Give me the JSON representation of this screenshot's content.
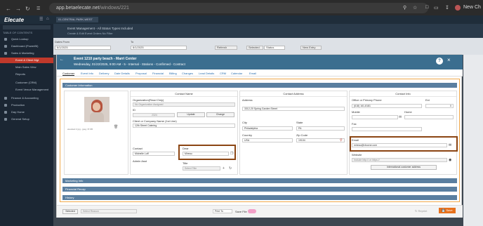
{
  "browser": {
    "url_host": "app.betaelecate.net",
    "url_path": "/windows/221",
    "profile_label": "New Ch"
  },
  "app": {
    "logo": "Elecate",
    "site_selector": "01-CENTRAL PARK-WEST"
  },
  "sidebar": {
    "heading": "TABLE OF CONTENTS",
    "items": [
      {
        "label": "Quick Lookup"
      },
      {
        "label": "Dashboard (PowerBI)"
      },
      {
        "label": "Sales & Marketing"
      },
      {
        "label": "Event & Client Mgt"
      },
      {
        "label": "Main Sales View"
      },
      {
        "label": "Reports"
      },
      {
        "label": "Customer (CRM)"
      },
      {
        "label": "Event Venue Management"
      },
      {
        "label": "Finance & Accounting"
      },
      {
        "label": "Production"
      },
      {
        "label": "Day Home"
      },
      {
        "label": "General Setup"
      }
    ]
  },
  "topstrip": {
    "title": "Event Management - All Status Types Included",
    "subtitle": "Create & Edit Event Orders No Filter"
  },
  "filters": {
    "date_from_label": "Dates From",
    "date_from": "6/1/2025",
    "to_label": "To",
    "date_to": "8/1/2025",
    "refresh": "Refresh",
    "selected": "Selected",
    "status": "Status",
    "new_entry": "New Entry"
  },
  "modal": {
    "title": "Event 1210 party beach - Marri Center",
    "subtitle": "Wednesday, 01/22/2025, 9:00 AM - 5 - Internal - Stations - Confirmed - Contract",
    "help_icon": "?",
    "tabs": [
      "Customer",
      "Event Info",
      "Delivery",
      "Date Details",
      "Proposal",
      "Financial",
      "Billing",
      "Changes",
      "Lead Details",
      "CRM",
      "Calendar",
      "Email"
    ],
    "section_customer": "Customer Information",
    "photo_caption": "elevated 2 jpg - jpeg / 8 KB",
    "contact_name": {
      "title": "Contact Name",
      "org_label": "Organization(Read Only)",
      "org_placeholder": "No Organization Assigned",
      "id_label": "ID",
      "id_value": "2324",
      "update": "Update",
      "change": "Change",
      "client_label": "Client or Company Name (1st Line)",
      "client_value": "12th Street Catering",
      "contact_label": "Contact",
      "contact_value": "Michelle Luff",
      "admin_label": "Admin Asst",
      "dear_label": "Dear",
      "dear_value": "Mireau",
      "title_label": "Title",
      "title_placeholder": "Select Title"
    },
    "contact_address": {
      "title": "Contact Address",
      "address_label": "Address",
      "address_value": "3312-20 Spring Garden Street",
      "city_label": "City",
      "city_value": "Philadelphia",
      "state_label": "State",
      "state_value": "PA",
      "country_label": "Country",
      "country_value": "USA",
      "zip_label": "Zip Code",
      "zip_value": "19104"
    },
    "contact_info": {
      "title": "Contact Info",
      "office_label": "Office or Primary Phone",
      "office_value": "(618) 161-8181",
      "ext_label": "Ext",
      "ext_value": "0",
      "mobile_label": "Mobile",
      "home_label": "Home",
      "fax_label": "Fax",
      "email_label": "Email",
      "email_value": "mireau@vbuxne.com",
      "website_label": "Website",
      "website_placeholder": "Include http:// or https://",
      "intl_button": "International customer address"
    },
    "section_marketing": "Marketing Info",
    "section_financial": "Financial Recap",
    "section_history": "History",
    "footer": {
      "selected": "Selected",
      "select_reason": "Select Reason",
      "print_to": "Print To",
      "save_file": "Save File",
      "reprint": "Reprint",
      "save": "Save"
    }
  }
}
